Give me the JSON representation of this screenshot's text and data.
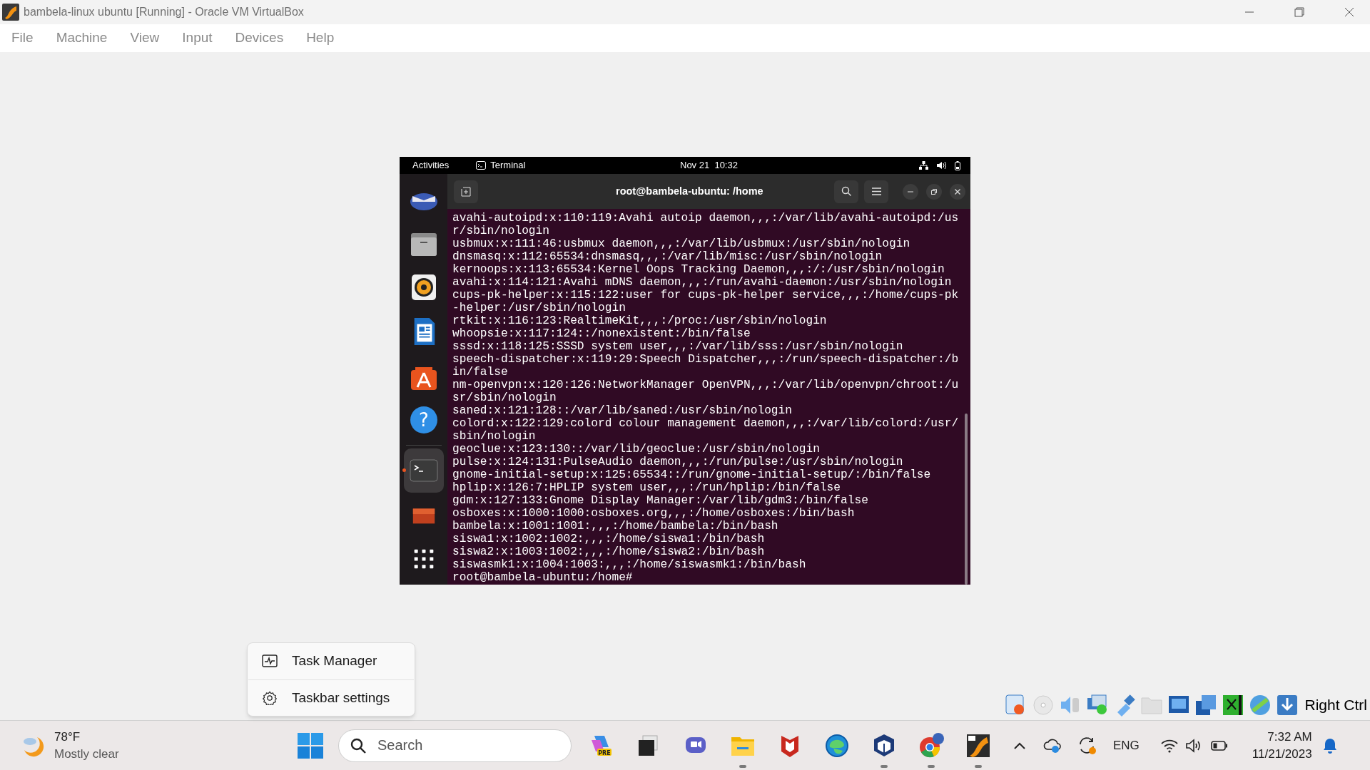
{
  "window": {
    "title": "bambela-linux ubuntu [Running] - Oracle VM VirtualBox"
  },
  "menu": [
    "File",
    "Machine",
    "View",
    "Input",
    "Devices",
    "Help"
  ],
  "vm": {
    "topbar": {
      "activities": "Activities",
      "app": "Terminal",
      "clock": "Nov 21  10:32"
    },
    "dock": [
      {
        "kind": "mail",
        "selected": false
      },
      {
        "kind": "files",
        "selected": false
      },
      {
        "kind": "music",
        "selected": false
      },
      {
        "kind": "writer",
        "selected": false
      },
      {
        "kind": "store",
        "selected": false
      },
      {
        "kind": "help",
        "glyph": "?",
        "selected": false
      },
      {
        "kind": "terminal",
        "selected": true
      },
      {
        "kind": "trash",
        "selected": false
      },
      {
        "kind": "apps",
        "selected": false
      }
    ],
    "terminal": {
      "title": "root@bambela-ubuntu: /home",
      "lines": [
        "avahi-autoipd:x:110:119:Avahi autoip daemon,,,:/var/lib/avahi-autoipd:/usr/sbin/nologin",
        "usbmux:x:111:46:usbmux daemon,,,:/var/lib/usbmux:/usr/sbin/nologin",
        "dnsmasq:x:112:65534:dnsmasq,,,:/var/lib/misc:/usr/sbin/nologin",
        "kernoops:x:113:65534:Kernel Oops Tracking Daemon,,,:/:/usr/sbin/nologin",
        "avahi:x:114:121:Avahi mDNS daemon,,,:/run/avahi-daemon:/usr/sbin/nologin",
        "cups-pk-helper:x:115:122:user for cups-pk-helper service,,,:/home/cups-pk-helper:/usr/sbin/nologin",
        "rtkit:x:116:123:RealtimeKit,,,:/proc:/usr/sbin/nologin",
        "whoopsie:x:117:124::/nonexistent:/bin/false",
        "sssd:x:118:125:SSSD system user,,,:/var/lib/sss:/usr/sbin/nologin",
        "speech-dispatcher:x:119:29:Speech Dispatcher,,,:/run/speech-dispatcher:/bin/false",
        "nm-openvpn:x:120:126:NetworkManager OpenVPN,,,:/var/lib/openvpn/chroot:/usr/sbin/nologin",
        "saned:x:121:128::/var/lib/saned:/usr/sbin/nologin",
        "colord:x:122:129:colord colour management daemon,,,:/var/lib/colord:/usr/sbin/nologin",
        "geoclue:x:123:130::/var/lib/geoclue:/usr/sbin/nologin",
        "pulse:x:124:131:PulseAudio daemon,,,:/run/pulse:/usr/sbin/nologin",
        "gnome-initial-setup:x:125:65534::/run/gnome-initial-setup/:/bin/false",
        "hplip:x:126:7:HPLIP system user,,,:/run/hplip:/bin/false",
        "gdm:x:127:133:Gnome Display Manager:/var/lib/gdm3:/bin/false",
        "osboxes:x:1000:1000:osboxes.org,,,:/home/osboxes:/bin/bash",
        "bambela:x:1001:1001:,,,:/home/bambela:/bin/bash",
        "siswa1:x:1002:1002:,,,:/home/siswa1:/bin/bash",
        "siswa2:x:1003:1002:,,,:/home/siswa2:/bin/bash",
        "siswasmk1:x:1004:1003:,,,:/home/siswasmk1:/bin/bash"
      ],
      "prompt": "root@bambela-ubuntu:/home#"
    }
  },
  "context_menu": [
    {
      "kind": "task-manager",
      "label": "Task Manager"
    },
    {
      "kind": "settings",
      "label": "Taskbar settings"
    }
  ],
  "status_icons": [
    {
      "kind": "disk"
    },
    {
      "kind": "optical"
    },
    {
      "kind": "audio"
    },
    {
      "kind": "network"
    },
    {
      "kind": "usb"
    },
    {
      "kind": "shared-folder"
    },
    {
      "kind": "display"
    },
    {
      "kind": "recording"
    },
    {
      "kind": "mouse"
    },
    {
      "kind": "mouse-integration"
    },
    {
      "kind": "download"
    }
  ],
  "host_key": "Right Ctrl",
  "taskbar": {
    "weather": {
      "temp": "78°F",
      "condition": "Mostly clear"
    },
    "search": {
      "placeholder": "Search"
    },
    "apps": [
      {
        "kind": "copilot",
        "badge": "PRE",
        "running": false
      },
      {
        "kind": "taskview",
        "running": false
      },
      {
        "kind": "chat",
        "running": false
      },
      {
        "kind": "explorer",
        "running": true
      },
      {
        "kind": "mcafee",
        "running": false
      },
      {
        "kind": "edge",
        "running": false
      },
      {
        "kind": "virtualbox",
        "running": true
      },
      {
        "kind": "chrome",
        "running": true
      },
      {
        "kind": "vbox64",
        "running": true
      }
    ],
    "language": "ENG",
    "time": "7:32 AM",
    "date": "11/21/2023"
  }
}
